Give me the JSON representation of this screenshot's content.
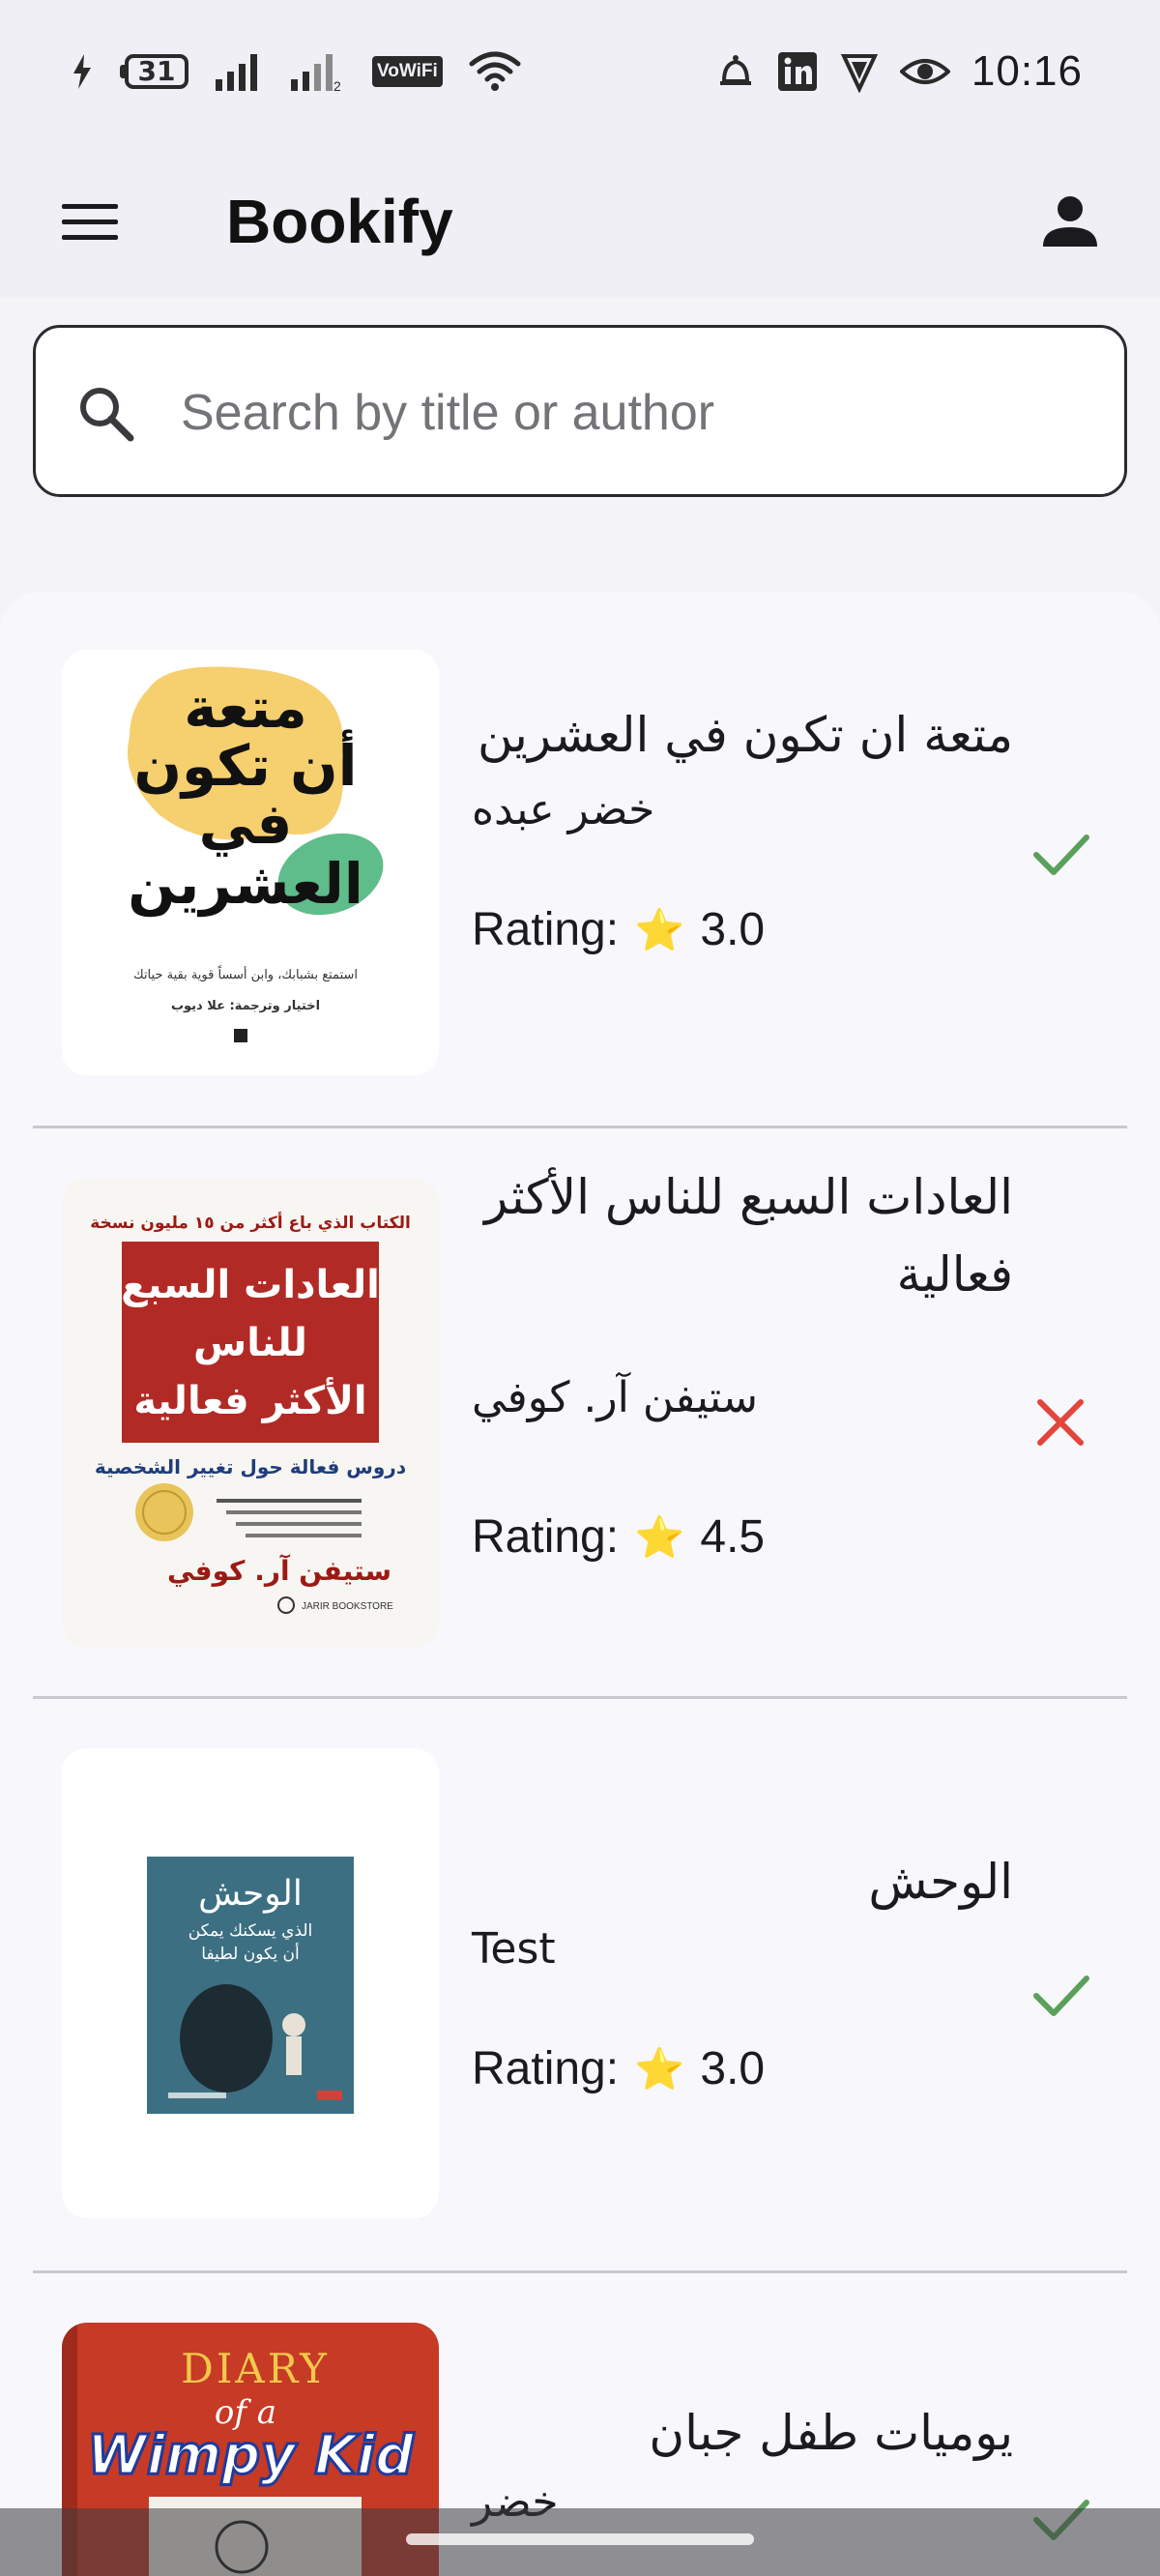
{
  "status_bar": {
    "battery": "31",
    "wifi_label": "VoWiFi",
    "time": "10:16"
  },
  "app_bar": {
    "title": "Bookify"
  },
  "search": {
    "placeholder": "Search by title or author",
    "value": ""
  },
  "books": [
    {
      "title": "متعة ان تكون في العشرين",
      "author": "خضر عبده",
      "rating_label": "Rating:",
      "rating_star": "⭐",
      "rating": "3.0",
      "status": "read",
      "cover": {
        "title_lines": [
          "متعة",
          "أن تكون",
          "في",
          "العشرين"
        ],
        "subtitle": "استمتع بشبابك، وابن أسساً قوية بقية حياتك",
        "credit": "اختيار وترجمة: علا ديوب"
      }
    },
    {
      "title": "العادات السبع للناس الأكثر فعالية",
      "author": "ستيفن آر. كوفي",
      "rating_label": "Rating:",
      "rating_star": "⭐",
      "rating": "4.5",
      "status": "not_read",
      "cover": {
        "top_line": "الكتاب الذي باع أكثر من ١٥ مليون نسخة",
        "title_lines": [
          "العادات السبع",
          "للناس",
          "الأكثر فعالية"
        ],
        "subtitle": "دروس فعالة حول تغيير الشخصية",
        "author": "ستيفن آر. كوفي",
        "publisher": "JARIR BOOKSTORE"
      }
    },
    {
      "title": "الوحش",
      "author": "Test",
      "rating_label": "Rating:",
      "rating_star": "⭐",
      "rating": "3.0",
      "status": "read",
      "cover": {
        "title_lines": [
          "الوحش",
          "الذي يسكنك يمكن",
          "أن يكون لطيفا"
        ]
      }
    },
    {
      "title": "يوميات طفل جبان",
      "author": "خضر",
      "status": "read",
      "cover": {
        "line1": "DIARY",
        "line2": "of a",
        "line3": "Wimpy Kid"
      }
    }
  ],
  "colors": {
    "check": "#5aa05a",
    "cross": "#e2453c",
    "background": "#f4f3f8"
  }
}
